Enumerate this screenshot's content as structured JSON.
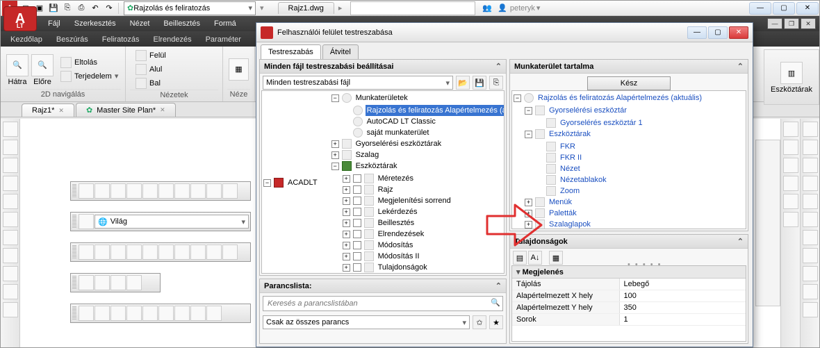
{
  "app": {
    "title_combo": "Rajzolás és feliratozás",
    "document": "Rajz1.dwg",
    "user": "peteryk"
  },
  "menubar": [
    "Fájl",
    "Szerkesztés",
    "Nézet",
    "Beillesztés",
    "Formá"
  ],
  "ribbon_tabs": [
    "Kezdőlap",
    "Beszúrás",
    "Feliratozás",
    "Elrendezés",
    "Paraméter"
  ],
  "ribbon": {
    "nav": {
      "back": "Hátra",
      "fwd": "Előre",
      "pan": "Eltolás",
      "extent": "Terjedelem",
      "title": "2D navigálás"
    },
    "views": {
      "top": "Felül",
      "bottom": "Alul",
      "left": "Bal",
      "title": "Nézetek"
    },
    "viewports": {
      "btn": "Néze"
    },
    "toolbars": {
      "title": "Eszköztárak"
    }
  },
  "drawing_tabs": [
    {
      "label": "Rajz1*",
      "active": true
    },
    {
      "label": "Master Site Plan*",
      "active": false
    }
  ],
  "world_combo": "Világ",
  "dialog": {
    "title": "Felhasználói felület testreszabása",
    "tabs": [
      "Testreszabás",
      "Átvitel"
    ],
    "left_header": "Minden fájl testreszabási beállításai",
    "left_combo": "Minden testreszabási fájl",
    "tree_root": "ACADLT",
    "workspaces": {
      "label": "Munkaterületek",
      "items": [
        {
          "label": "Rajzolás és feliratozás Alapértelmezés (aktuális)",
          "sel": true
        },
        {
          "label": "AutoCAD LT Classic"
        },
        {
          "label": "saját munkaterület"
        }
      ]
    },
    "qat": "Gyorselérési eszköztárak",
    "ribbon_node": "Szalag",
    "toolbars_node": {
      "label": "Eszköztárak",
      "items": [
        "Méretezés",
        "Rajz",
        "Megjelenítési sorrend",
        "Lekérdezés",
        "Beillesztés",
        "Elrendezések",
        "Módosítás",
        "Módosítás II",
        "Tulajdonságok"
      ]
    },
    "cmdlist": {
      "header": "Parancslista:",
      "placeholder": "Keresés a parancslistában",
      "filter": "Csak az összes parancs"
    },
    "right_header": "Munkaterület tartalma",
    "ready": "Kész",
    "ws_tree": {
      "root": "Rajzolás és feliratozás Alapértelmezés (aktuális)",
      "qat": "Gyorselérési eszköztár",
      "qat1": "Gyorselérés eszköztár 1",
      "toolbars": "Eszköztárak",
      "tb_items": [
        "FKR",
        "FKR II",
        "Nézet",
        "Nézetablakok",
        "Zoom"
      ],
      "menus": "Menük",
      "palettes": "Paletták",
      "ribbon_tabs": "Szalaglapok"
    },
    "props": {
      "header": "Tulajdonságok",
      "cat": "Megjelenés",
      "rows": [
        {
          "k": "Tájolás",
          "v": "Lebegő"
        },
        {
          "k": "Alapértelmezett X hely",
          "v": "100"
        },
        {
          "k": "Alapértelmezett Y hely",
          "v": "350"
        },
        {
          "k": "Sorok",
          "v": "1"
        }
      ]
    }
  }
}
